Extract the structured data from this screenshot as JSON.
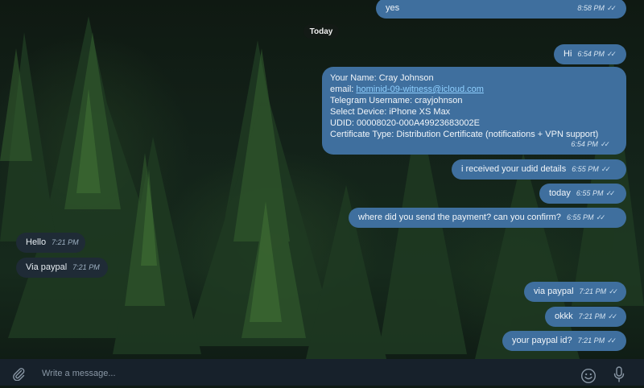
{
  "date_separator": "Today",
  "messages": [
    {
      "direction": "out",
      "text": "yes",
      "time": "8:58 PM",
      "read": true
    },
    {
      "direction": "out",
      "text": "Hi",
      "time": "6:54 PM",
      "read": true
    },
    {
      "direction": "out",
      "type": "details",
      "time": "6:54 PM",
      "read": true,
      "name_line": "Your Name: Cray Johnson",
      "email_label": "email: ",
      "email_value": "hominid-09-witness@icloud.com",
      "telegram_line": "Telegram Username: crayjohnson",
      "device_line": "Select Device: iPhone XS Max",
      "udid_line": "UDID: 00008020-000A49923683002E",
      "cert_line": "Certificate Type: Distribution Certificate (notifications + VPN support)"
    },
    {
      "direction": "out",
      "text": "i received your udid details",
      "time": "6:55 PM",
      "read": true
    },
    {
      "direction": "out",
      "text": "today",
      "time": "6:55 PM",
      "read": true
    },
    {
      "direction": "out",
      "text": "where did you send the payment? can you confirm?",
      "time": "6:55 PM",
      "read": true
    },
    {
      "direction": "in",
      "text": "Hello",
      "time": "7:21 PM"
    },
    {
      "direction": "in",
      "text": "Via paypal",
      "time": "7:21 PM"
    },
    {
      "direction": "out",
      "text": "via paypal",
      "time": "7:21 PM",
      "read": true
    },
    {
      "direction": "out",
      "text": "okkk",
      "time": "7:21 PM",
      "read": true
    },
    {
      "direction": "out",
      "text": "your paypal id?",
      "time": "7:21 PM",
      "read": true
    }
  ],
  "composer": {
    "placeholder": "Write a message..."
  },
  "icons": {
    "attach": "paperclip-icon",
    "emoji": "emoji-icon",
    "voice": "microphone-icon",
    "read": "double-check-icon"
  },
  "colors": {
    "outgoing_bubble": "#3f6f9e",
    "incoming_bubble": "#1f2b36",
    "composer_bg": "#17212b",
    "link": "#8fd0ff"
  }
}
